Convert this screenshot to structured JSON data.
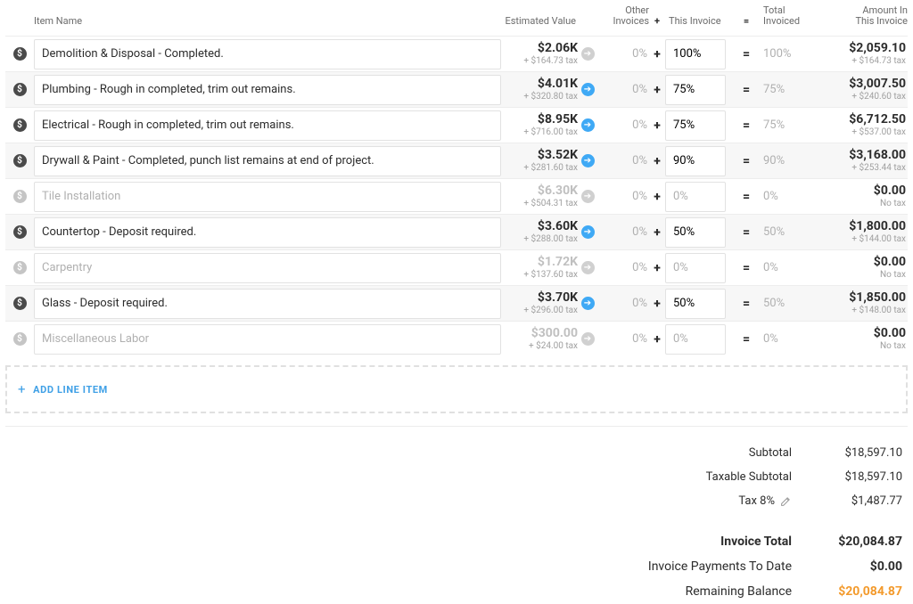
{
  "headers": {
    "item": "Item Name",
    "estimated": "Estimated Value",
    "other": "Other\nInvoices",
    "this": "This Invoice",
    "total": "Total\nInvoiced",
    "amount": "Amount In\nThis Invoice"
  },
  "rows": [
    {
      "active": true,
      "name": "Demolition & Disposal - Completed.",
      "est": "$2.06K",
      "est_tax": "+ $164.73 tax",
      "arrow": "grey",
      "other": "0%",
      "this": "100%",
      "total": "100%",
      "amt": "$2,059.10",
      "amt_tax": "+ $164.73 tax"
    },
    {
      "active": true,
      "name": "Plumbing - Rough in completed, trim out remains.",
      "est": "$4.01K",
      "est_tax": "+ $320.80 tax",
      "arrow": "blue",
      "other": "0%",
      "this": "75%",
      "total": "75%",
      "amt": "$3,007.50",
      "amt_tax": "+ $240.60 tax"
    },
    {
      "active": true,
      "name": "Electrical - Rough in completed, trim out remains.",
      "est": "$8.95K",
      "est_tax": "+ $716.00 tax",
      "arrow": "blue",
      "other": "0%",
      "this": "75%",
      "total": "75%",
      "amt": "$6,712.50",
      "amt_tax": "+ $537.00 tax"
    },
    {
      "active": true,
      "name": "Drywall & Paint - Completed, punch list remains at end of project.",
      "est": "$3.52K",
      "est_tax": "+ $281.60 tax",
      "arrow": "blue",
      "other": "0%",
      "this": "90%",
      "total": "90%",
      "amt": "$3,168.00",
      "amt_tax": "+ $253.44 tax"
    },
    {
      "active": false,
      "name": "Tile Installation",
      "est": "$6.30K",
      "est_tax": "+ $504.31 tax",
      "arrow": "grey",
      "other": "0%",
      "this": "0%",
      "total": "0%",
      "amt": "$0.00",
      "amt_tax": "No tax"
    },
    {
      "active": true,
      "name": "Countertop - Deposit required.",
      "est": "$3.60K",
      "est_tax": "+ $288.00 tax",
      "arrow": "blue",
      "other": "0%",
      "this": "50%",
      "total": "50%",
      "amt": "$1,800.00",
      "amt_tax": "+ $144.00 tax"
    },
    {
      "active": false,
      "name": "Carpentry",
      "est": "$1.72K",
      "est_tax": "+ $137.60 tax",
      "arrow": "grey",
      "other": "0%",
      "this": "0%",
      "total": "0%",
      "amt": "$0.00",
      "amt_tax": "No tax"
    },
    {
      "active": true,
      "name": "Glass - Deposit required.",
      "est": "$3.70K",
      "est_tax": "+ $296.00 tax",
      "arrow": "blue",
      "other": "0%",
      "this": "50%",
      "total": "50%",
      "amt": "$1,850.00",
      "amt_tax": "+ $148.00 tax"
    },
    {
      "active": false,
      "name": "Miscellaneous Labor",
      "est": "$300.00",
      "est_tax": "+ $24.00 tax",
      "arrow": "grey",
      "other": "0%",
      "this": "0%",
      "total": "0%",
      "amt": "$0.00",
      "amt_tax": "No tax"
    }
  ],
  "add_line": "ADD LINE ITEM",
  "totals": {
    "subtotal_label": "Subtotal",
    "subtotal": "$18,597.10",
    "taxable_label": "Taxable Subtotal",
    "taxable": "$18,597.10",
    "tax_label": "Tax 8%",
    "tax": "$1,487.77",
    "invoice_total_label": "Invoice Total",
    "invoice_total": "$20,084.87",
    "payments_label": "Invoice Payments To Date",
    "payments": "$0.00",
    "balance_label": "Remaining Balance",
    "balance": "$20,084.87"
  }
}
